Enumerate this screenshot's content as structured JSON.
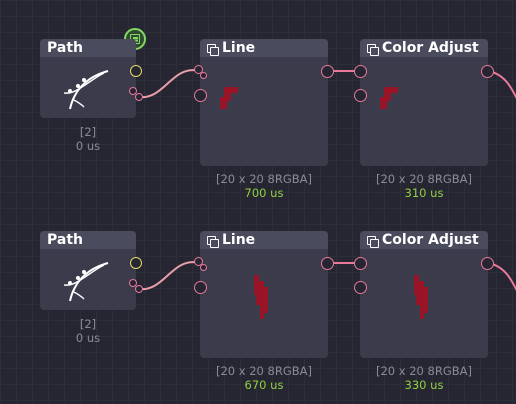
{
  "graph": {
    "rows": [
      {
        "path_node": {
          "title": "Path",
          "count": "[2]",
          "time": "0 us"
        },
        "line_node": {
          "title": "Line",
          "size": "[20 x 20 8RGBA]",
          "time": "700 us"
        },
        "color_node": {
          "title": "Color Adjust",
          "size": "[20 x 20 8RGBA]",
          "time": "310 us"
        }
      },
      {
        "path_node": {
          "title": "Path",
          "count": "[2]",
          "time": "0 us"
        },
        "line_node": {
          "title": "Line",
          "size": "[20 x 20 8RGBA]",
          "time": "670 us"
        },
        "color_node": {
          "title": "Color Adjust",
          "size": "[20 x 20 8RGBA]",
          "time": "330 us"
        }
      }
    ],
    "active_node_icon": "list-badge-icon",
    "colors": {
      "background": "#262632",
      "node_body": "#3b3b4c",
      "node_header": "#4b4b5e",
      "image_socket": "#e8799a",
      "path_socket": "#e8d86a",
      "wire": "#e8a0a8",
      "timing": "#90d040",
      "preview_fill": "#9a1428"
    }
  }
}
